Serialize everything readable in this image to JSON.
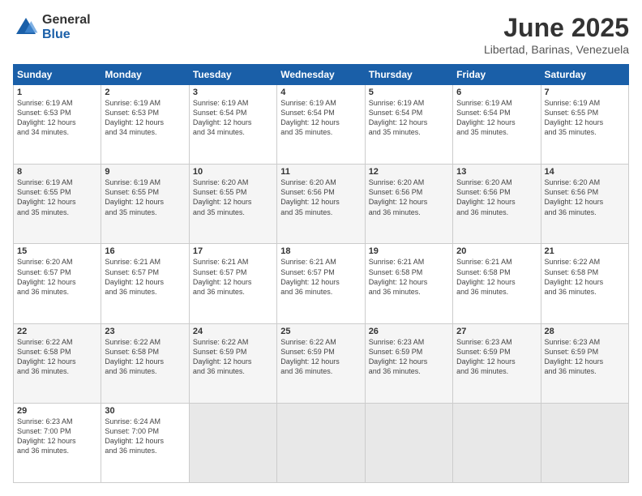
{
  "logo": {
    "general": "General",
    "blue": "Blue"
  },
  "title": "June 2025",
  "location": "Libertad, Barinas, Venezuela",
  "days_header": [
    "Sunday",
    "Monday",
    "Tuesday",
    "Wednesday",
    "Thursday",
    "Friday",
    "Saturday"
  ],
  "weeks": [
    [
      {
        "day": "1",
        "rise": "6:19 AM",
        "set": "6:53 PM",
        "hours": "12 hours",
        "mins": "34"
      },
      {
        "day": "2",
        "rise": "6:19 AM",
        "set": "6:53 PM",
        "hours": "12 hours",
        "mins": "34"
      },
      {
        "day": "3",
        "rise": "6:19 AM",
        "set": "6:54 PM",
        "hours": "12 hours",
        "mins": "34"
      },
      {
        "day": "4",
        "rise": "6:19 AM",
        "set": "6:54 PM",
        "hours": "12 hours",
        "mins": "35"
      },
      {
        "day": "5",
        "rise": "6:19 AM",
        "set": "6:54 PM",
        "hours": "12 hours",
        "mins": "35"
      },
      {
        "day": "6",
        "rise": "6:19 AM",
        "set": "6:54 PM",
        "hours": "12 hours",
        "mins": "35"
      },
      {
        "day": "7",
        "rise": "6:19 AM",
        "set": "6:55 PM",
        "hours": "12 hours",
        "mins": "35"
      }
    ],
    [
      {
        "day": "8",
        "rise": "6:19 AM",
        "set": "6:55 PM",
        "hours": "12 hours",
        "mins": "35"
      },
      {
        "day": "9",
        "rise": "6:19 AM",
        "set": "6:55 PM",
        "hours": "12 hours",
        "mins": "35"
      },
      {
        "day": "10",
        "rise": "6:20 AM",
        "set": "6:55 PM",
        "hours": "12 hours",
        "mins": "35"
      },
      {
        "day": "11",
        "rise": "6:20 AM",
        "set": "6:56 PM",
        "hours": "12 hours",
        "mins": "35"
      },
      {
        "day": "12",
        "rise": "6:20 AM",
        "set": "6:56 PM",
        "hours": "12 hours",
        "mins": "36"
      },
      {
        "day": "13",
        "rise": "6:20 AM",
        "set": "6:56 PM",
        "hours": "12 hours",
        "mins": "36"
      },
      {
        "day": "14",
        "rise": "6:20 AM",
        "set": "6:56 PM",
        "hours": "12 hours",
        "mins": "36"
      }
    ],
    [
      {
        "day": "15",
        "rise": "6:20 AM",
        "set": "6:57 PM",
        "hours": "12 hours",
        "mins": "36"
      },
      {
        "day": "16",
        "rise": "6:21 AM",
        "set": "6:57 PM",
        "hours": "12 hours",
        "mins": "36"
      },
      {
        "day": "17",
        "rise": "6:21 AM",
        "set": "6:57 PM",
        "hours": "12 hours",
        "mins": "36"
      },
      {
        "day": "18",
        "rise": "6:21 AM",
        "set": "6:57 PM",
        "hours": "12 hours",
        "mins": "36"
      },
      {
        "day": "19",
        "rise": "6:21 AM",
        "set": "6:58 PM",
        "hours": "12 hours",
        "mins": "36"
      },
      {
        "day": "20",
        "rise": "6:21 AM",
        "set": "6:58 PM",
        "hours": "12 hours",
        "mins": "36"
      },
      {
        "day": "21",
        "rise": "6:22 AM",
        "set": "6:58 PM",
        "hours": "12 hours",
        "mins": "36"
      }
    ],
    [
      {
        "day": "22",
        "rise": "6:22 AM",
        "set": "6:58 PM",
        "hours": "12 hours",
        "mins": "36"
      },
      {
        "day": "23",
        "rise": "6:22 AM",
        "set": "6:58 PM",
        "hours": "12 hours",
        "mins": "36"
      },
      {
        "day": "24",
        "rise": "6:22 AM",
        "set": "6:59 PM",
        "hours": "12 hours",
        "mins": "36"
      },
      {
        "day": "25",
        "rise": "6:22 AM",
        "set": "6:59 PM",
        "hours": "12 hours",
        "mins": "36"
      },
      {
        "day": "26",
        "rise": "6:23 AM",
        "set": "6:59 PM",
        "hours": "12 hours",
        "mins": "36"
      },
      {
        "day": "27",
        "rise": "6:23 AM",
        "set": "6:59 PM",
        "hours": "12 hours",
        "mins": "36"
      },
      {
        "day": "28",
        "rise": "6:23 AM",
        "set": "6:59 PM",
        "hours": "12 hours",
        "mins": "36"
      }
    ],
    [
      {
        "day": "29",
        "rise": "6:23 AM",
        "set": "7:00 PM",
        "hours": "12 hours",
        "mins": "36"
      },
      {
        "day": "30",
        "rise": "6:24 AM",
        "set": "7:00 PM",
        "hours": "12 hours",
        "mins": "36"
      },
      null,
      null,
      null,
      null,
      null
    ]
  ],
  "labels": {
    "sunrise": "Sunrise:",
    "sunset": "Sunset:",
    "daylight": "Daylight:",
    "and": "and",
    "minutes": "minutes."
  }
}
